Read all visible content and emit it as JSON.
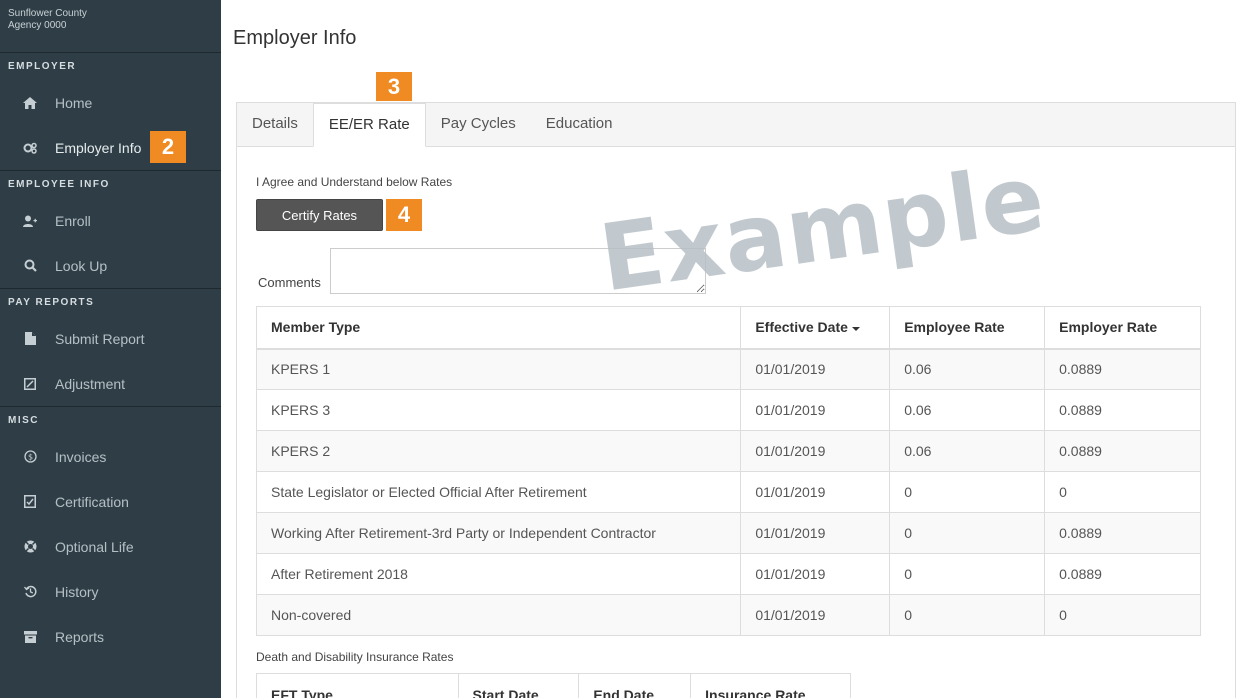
{
  "sidebar": {
    "agency_line1": "Sunflower County",
    "agency_line2": "Agency 0000",
    "sections": {
      "employer": "EMPLOYER",
      "employee_info": "EMPLOYEE INFO",
      "pay_reports": "PAY REPORTS",
      "misc": "MISC"
    },
    "items": {
      "home": {
        "label": "Home",
        "icon": "home-icon"
      },
      "employer_info": {
        "label": "Employer Info",
        "icon": "gears-icon"
      },
      "enroll": {
        "label": "Enroll",
        "icon": "user-plus-icon"
      },
      "look_up": {
        "label": "Look Up",
        "icon": "search-icon"
      },
      "submit_report": {
        "label": "Submit Report",
        "icon": "file-icon"
      },
      "adjustment": {
        "label": "Adjustment",
        "icon": "edit-icon"
      },
      "invoices": {
        "label": "Invoices",
        "icon": "dollar-circle-icon"
      },
      "certification": {
        "label": "Certification",
        "icon": "check-file-icon"
      },
      "optional_life": {
        "label": "Optional Life",
        "icon": "life-ring-icon"
      },
      "history": {
        "label": "History",
        "icon": "history-icon"
      },
      "reports": {
        "label": "Reports",
        "icon": "archive-icon"
      }
    }
  },
  "badges": {
    "b2": "2",
    "b3": "3",
    "b4": "4"
  },
  "main": {
    "title": "Employer Info",
    "tabs": [
      "Details",
      "EE/ER Rate",
      "Pay Cycles",
      "Education"
    ],
    "active_tab": "EE/ER Rate",
    "agree_text": "I Agree and Understand below Rates",
    "certify_button": "Certify Rates",
    "comments_label": "Comments",
    "comments_value": "",
    "watermark": "Example"
  },
  "rates_table": {
    "headers": {
      "member_type": "Member Type",
      "effective_date": "Effective Date",
      "employee_rate": "Employee Rate",
      "employer_rate": "Employer Rate"
    },
    "rows": [
      {
        "member_type": "KPERS 1",
        "effective_date": "01/01/2019",
        "employee_rate": "0.06",
        "employer_rate": "0.0889"
      },
      {
        "member_type": "KPERS 3",
        "effective_date": "01/01/2019",
        "employee_rate": "0.06",
        "employer_rate": "0.0889"
      },
      {
        "member_type": "KPERS 2",
        "effective_date": "01/01/2019",
        "employee_rate": "0.06",
        "employer_rate": "0.0889"
      },
      {
        "member_type": "State Legislator or Elected Official After Retirement",
        "effective_date": "01/01/2019",
        "employee_rate": "0",
        "employer_rate": "0"
      },
      {
        "member_type": "Working After Retirement-3rd Party or Independent Contractor",
        "effective_date": "01/01/2019",
        "employee_rate": "0",
        "employer_rate": "0.0889"
      },
      {
        "member_type": "After Retirement 2018",
        "effective_date": "01/01/2019",
        "employee_rate": "0",
        "employer_rate": "0.0889"
      },
      {
        "member_type": "Non-covered",
        "effective_date": "01/01/2019",
        "employee_rate": "0",
        "employer_rate": "0"
      }
    ]
  },
  "dd_section": {
    "label": "Death and Disability Insurance Rates",
    "headers": {
      "eft_type": "EFT Type",
      "start_date": "Start Date",
      "end_date": "End Date",
      "insurance_rate": "Insurance Rate"
    }
  },
  "colors": {
    "sidebar_bg": "#2f3e46",
    "badge": "#f08a22",
    "button": "#555555"
  }
}
